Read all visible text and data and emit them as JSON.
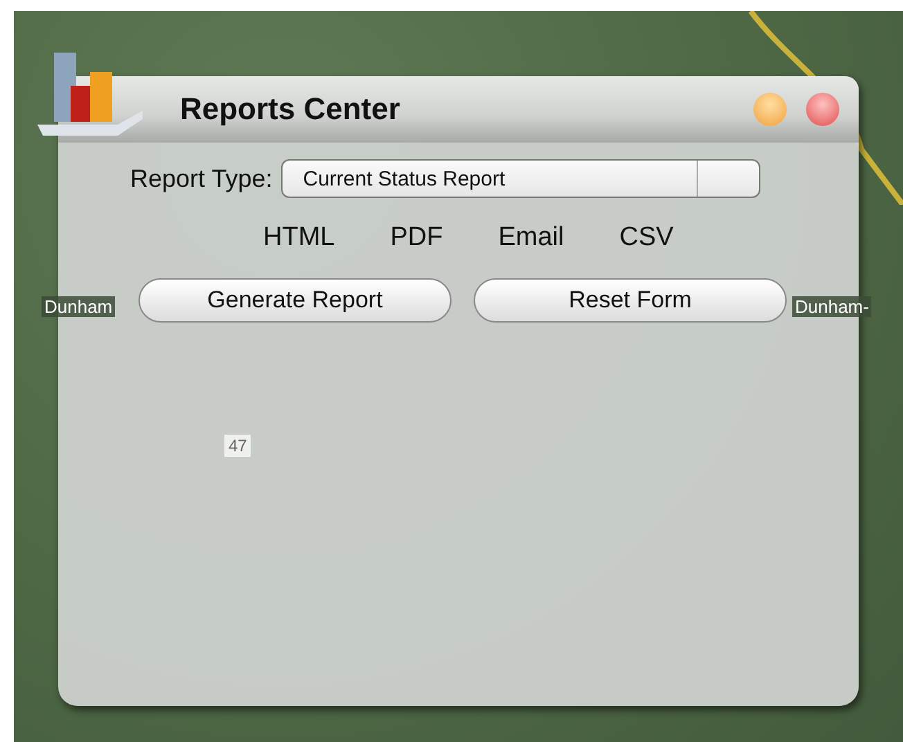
{
  "map": {
    "labels": [
      {
        "text": "Dunham",
        "kind": "place"
      },
      {
        "text": "Dunham-",
        "kind": "place"
      },
      {
        "text": "47",
        "kind": "route"
      }
    ]
  },
  "window": {
    "title": "Reports Center"
  },
  "report_type": {
    "label": "Report Type:",
    "value": "Current Status Report"
  },
  "formats": [
    "HTML",
    "PDF",
    "Email",
    "CSV"
  ],
  "buttons": [
    "Generate Report",
    "Reset Form"
  ]
}
